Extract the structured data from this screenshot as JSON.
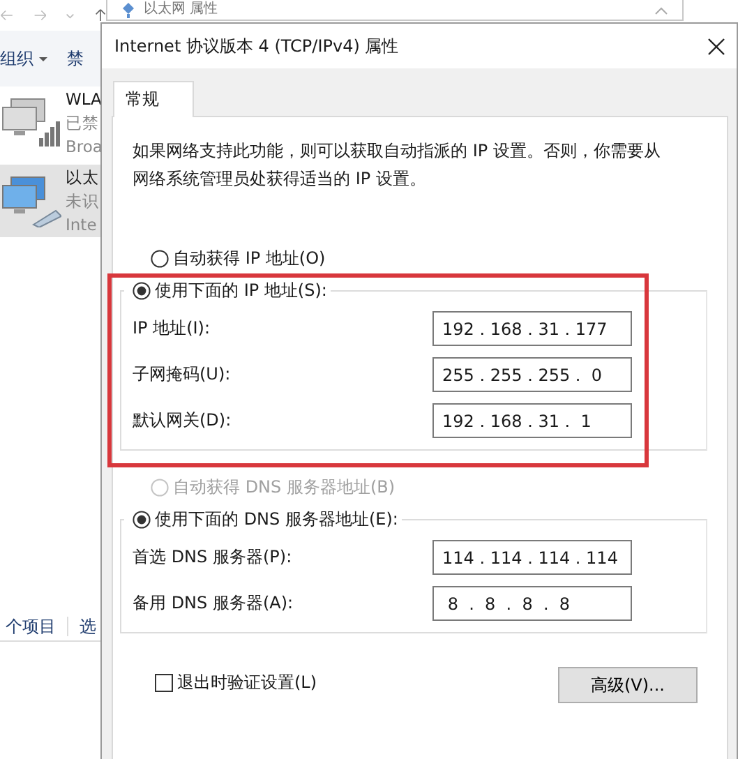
{
  "background_window": {
    "title": "以太网 属性"
  },
  "explorer": {
    "commands": [
      {
        "label": "组织",
        "dropdown": true
      },
      {
        "label": "禁",
        "dropdown": false
      }
    ],
    "items": [
      {
        "kind": "wireless",
        "name": "WLA",
        "status": "已禁",
        "detail": "Broa",
        "selected": false
      },
      {
        "kind": "ethernet",
        "name": "以太",
        "status": "未识",
        "detail": "Inte",
        "selected": true
      }
    ],
    "status_bar": [
      "个项目",
      "选"
    ]
  },
  "dialog": {
    "title": "Internet 协议版本 4 (TCP/IPv4) 属性",
    "tabs": [
      {
        "label": "常规",
        "selected": true
      }
    ],
    "description": "如果网络支持此功能，则可以获取自动指派的 IP 设置。否则，你需要从网络系统管理员处获得适当的 IP 设置。",
    "ip_auto": {
      "label": "自动获得 IP 地址(O)",
      "selected": false,
      "disabled": false
    },
    "ip_manual": {
      "label": "使用下面的 IP 地址(S):",
      "selected": true,
      "disabled": false,
      "highlighted": true,
      "fields": [
        {
          "label": "IP 地址(I):",
          "value": "192 . 168 . 31 . 177"
        },
        {
          "label": "子网掩码(U):",
          "value": "255 . 255 . 255 .  0"
        },
        {
          "label": "默认网关(D):",
          "value": "192 . 168 . 31 .  1"
        }
      ]
    },
    "dns_auto": {
      "label": "自动获得 DNS 服务器地址(B)",
      "selected": false,
      "disabled": true
    },
    "dns_manual": {
      "label": "使用下面的 DNS 服务器地址(E):",
      "selected": true,
      "disabled": false,
      "highlighted": false,
      "fields": [
        {
          "label": "首选 DNS 服务器(P):",
          "value": "114 . 114 . 114 . 114"
        },
        {
          "label": "备用 DNS 服务器(A):",
          "value": " 8  .  8  .  8  .  8"
        }
      ]
    },
    "validate": {
      "label": "退出时验证设置(L)",
      "checked": false
    },
    "advanced_button": "高级(V)..."
  }
}
